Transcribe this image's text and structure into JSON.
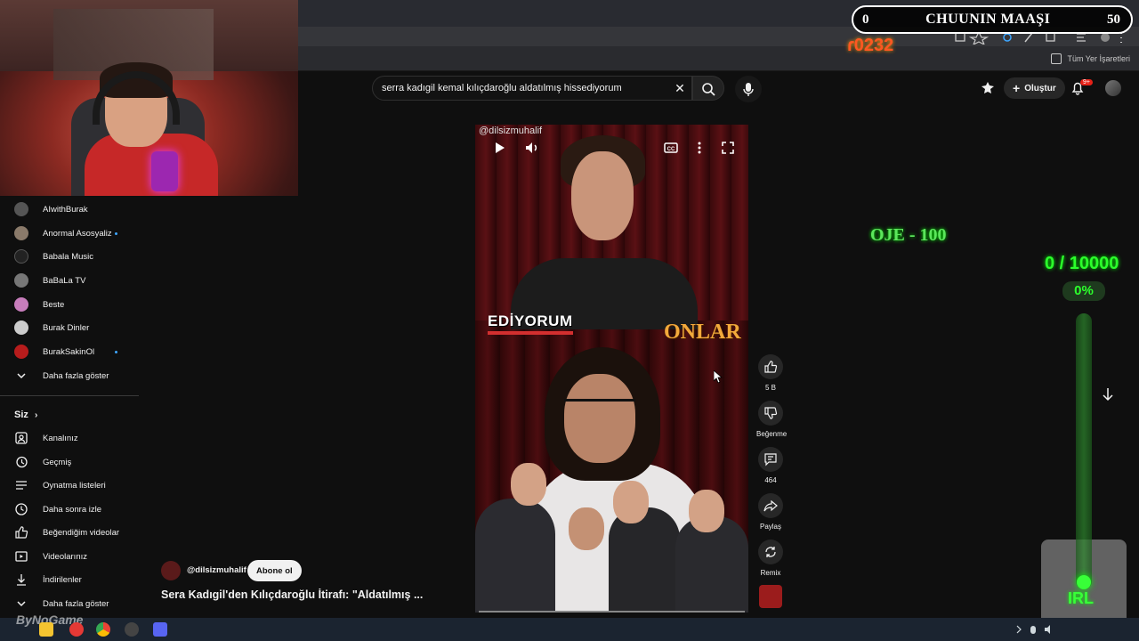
{
  "browser": {
    "bookmarks_all": "Tüm Yer İşaretleri"
  },
  "search": {
    "query": "serra kadıgil kemal kılıçdaroğlu aldatılmış hissediyorum"
  },
  "header": {
    "create_label": "Oluştur",
    "notification_count": "9+"
  },
  "sidebar": {
    "subscriptions": [
      {
        "label": "AIwithBurak",
        "color": "#555555",
        "new": false
      },
      {
        "label": "Anormal Asosyaliz",
        "color": "#8a7a6a",
        "new": true
      },
      {
        "label": "Babala Music",
        "color": "#222222",
        "new": false
      },
      {
        "label": "BaBaLa TV",
        "color": "#777777",
        "new": false
      },
      {
        "label": "Beste",
        "color": "#c77dbb",
        "new": false
      },
      {
        "label": "Burak Dinler",
        "color": "#cccccc",
        "new": false
      },
      {
        "label": "BurakSakinOl",
        "color": "#b71c1c",
        "new": true
      }
    ],
    "show_more": "Daha fazla göster",
    "you_heading": "Siz",
    "you_items": [
      {
        "label": "Kanalınız",
        "icon": "person-icon"
      },
      {
        "label": "Geçmiş",
        "icon": "history-icon"
      },
      {
        "label": "Oynatma listeleri",
        "icon": "playlist-icon"
      },
      {
        "label": "Daha sonra izle",
        "icon": "clock-icon"
      },
      {
        "label": "Beğendiğim videolar",
        "icon": "thumb-up-icon"
      },
      {
        "label": "Videolarınız",
        "icon": "video-icon"
      },
      {
        "label": "İndirilenler",
        "icon": "download-icon"
      },
      {
        "label": "Daha fazla göster",
        "icon": "chevron-down-icon"
      }
    ]
  },
  "video": {
    "watermark": "@dilsizmuhalif",
    "caption_left": "EDİYORUM",
    "caption_right": "ONLAR"
  },
  "actions": {
    "likes": "5 B",
    "dislike_label": "Beğenme",
    "comments": "464",
    "share_label": "Paylaş",
    "remix_label": "Remix"
  },
  "channel": {
    "name": "@dilsizmuhalif",
    "subscribe_label": "Abone ol",
    "title": "Sera Kadıgil'den Kılıçdaroğlu İtirafı: \"Aldatılmış ..."
  },
  "overlay": {
    "goal_left": "0",
    "goal_title": "CHUUNIN MAAŞI",
    "goal_right": "50",
    "counter": "ɾ0232",
    "proje": "OJE - 100",
    "progress_count": "0 / 10000",
    "progress_pct": "0%",
    "progress_fraction": 0,
    "irl": "IRL",
    "stream_watermark": "ByNoGame"
  },
  "colors": {
    "youtube_bg": "#0f0f0f",
    "accent_green": "#2cff2c",
    "notification_red": "#e62117"
  }
}
